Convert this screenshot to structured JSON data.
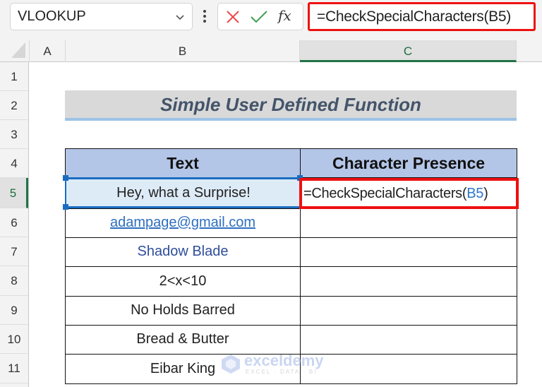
{
  "toolbar": {
    "name_box": "VLOOKUP",
    "name_box_icon": "chevron-down-icon",
    "more_icon": "vertical-dots-icon",
    "cancel_icon": "close-icon",
    "enter_icon": "check-icon",
    "fx_label": "fx",
    "formula": "=CheckSpecialCharacters(B5)",
    "highlight_color": "#ee1111"
  },
  "columns": [
    "A",
    "B",
    "C"
  ],
  "active_column": "C",
  "rows": [
    "1",
    "2",
    "3",
    "4",
    "5",
    "6",
    "7",
    "8",
    "9",
    "10",
    "11"
  ],
  "active_row": "5",
  "sheet": {
    "title": "Simple User Defined Function",
    "table": {
      "headers": [
        "Text",
        "Character Presence"
      ],
      "rows": [
        {
          "text": "Hey, what a Surprise!",
          "result": ""
        },
        {
          "text": "adampage@gmail.com",
          "result": ""
        },
        {
          "text": "Shadow Blade",
          "result": ""
        },
        {
          "text": "2<x<10",
          "result": ""
        },
        {
          "text": "No Holds Barred",
          "result": ""
        },
        {
          "text": "Bread & Butter",
          "result": ""
        },
        {
          "text": "Eibar King",
          "result": ""
        }
      ]
    },
    "editing_cell": {
      "prefix": "=CheckSpecialCharacters(",
      "ref": "B5",
      "suffix": ")"
    }
  },
  "watermark": {
    "name": "exceldemy",
    "tagline": "EXCEL · DATA · BI"
  },
  "colors": {
    "header_fill": "#b4c6e7",
    "title_fill": "#d9d9d9",
    "selection": "#1a6dc0",
    "excel_green": "#217346"
  }
}
